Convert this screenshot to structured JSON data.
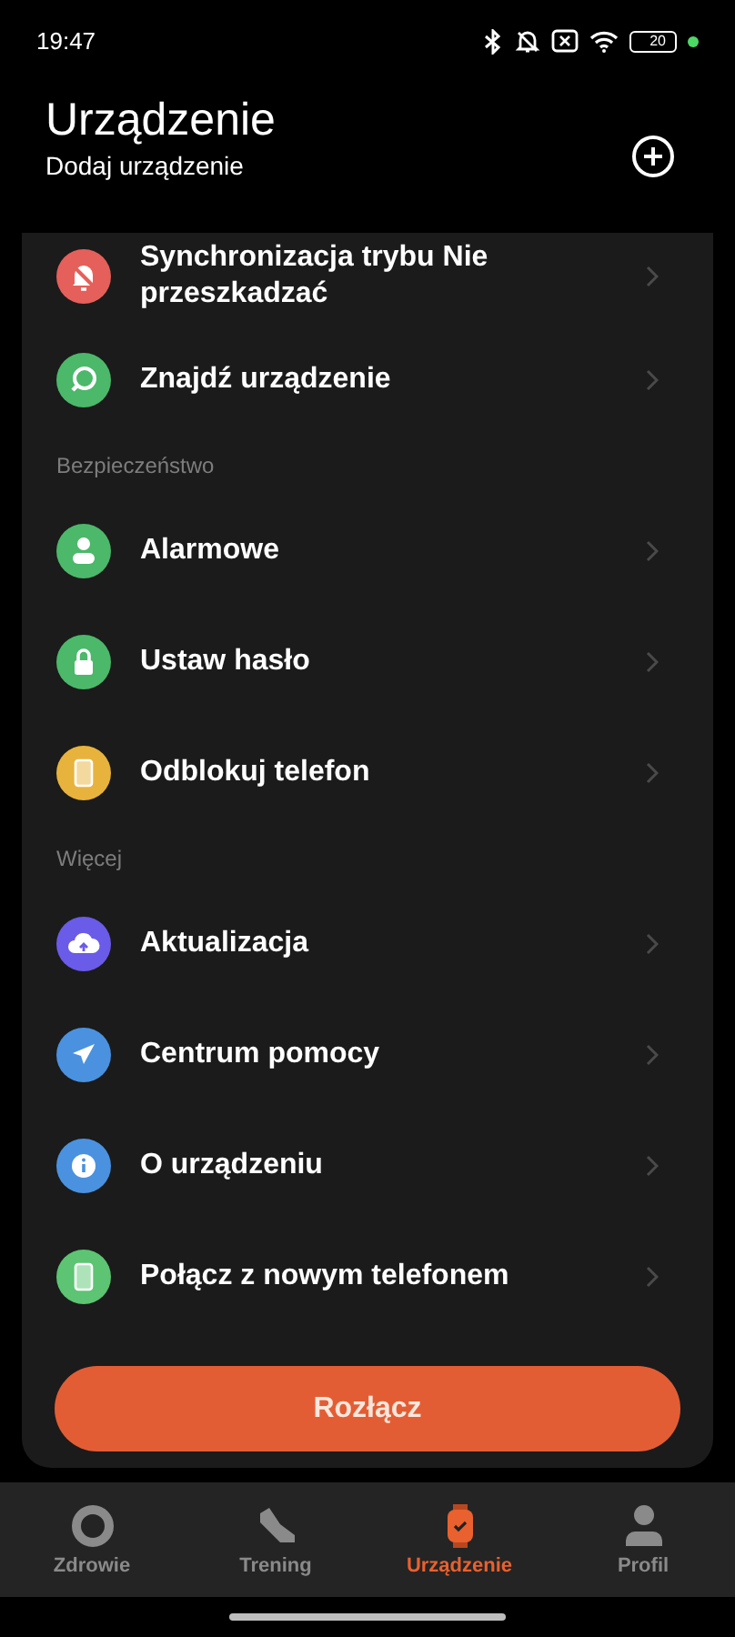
{
  "status_bar": {
    "time": "19:47",
    "battery": "20"
  },
  "header": {
    "title": "Urządzenie",
    "subtitle": "Dodaj urządzenie"
  },
  "sections": [
    {
      "items": [
        {
          "label": "Synchronizacja trybu Nie przeszkadzać",
          "kind": "dnd",
          "color": "#e5605a"
        },
        {
          "label": "Znajdź urządzenie",
          "kind": "find",
          "color": "#4cb86a"
        }
      ]
    },
    {
      "heading": "Bezpieczeństwo",
      "items": [
        {
          "label": "Alarmowe",
          "kind": "contact",
          "color": "#4cb86a"
        },
        {
          "label": "Ustaw hasło",
          "kind": "password",
          "color": "#4cb86a"
        },
        {
          "label": "Odblokuj telefon",
          "kind": "unlock",
          "color": "#e8b33c"
        }
      ]
    },
    {
      "heading": "Więcej",
      "items": [
        {
          "label": "Aktualizacja",
          "kind": "update",
          "color": "#6a5be8"
        },
        {
          "label": "Centrum pomocy",
          "kind": "help",
          "color": "#4a92e0"
        },
        {
          "label": "O urządzeniu",
          "kind": "about",
          "color": "#4a92e0"
        },
        {
          "label": "Połącz z nowym telefonem",
          "kind": "unlock",
          "color": "#5cc472"
        }
      ]
    }
  ],
  "button": "Rozłącz",
  "nav": [
    {
      "label": "Zdrowie",
      "kind": "health",
      "selected": false
    },
    {
      "label": "Trening",
      "kind": "workout",
      "selected": false
    },
    {
      "label": "Urządzenie",
      "kind": "device",
      "selected": true
    },
    {
      "label": "Profil",
      "kind": "profile",
      "selected": false
    }
  ]
}
